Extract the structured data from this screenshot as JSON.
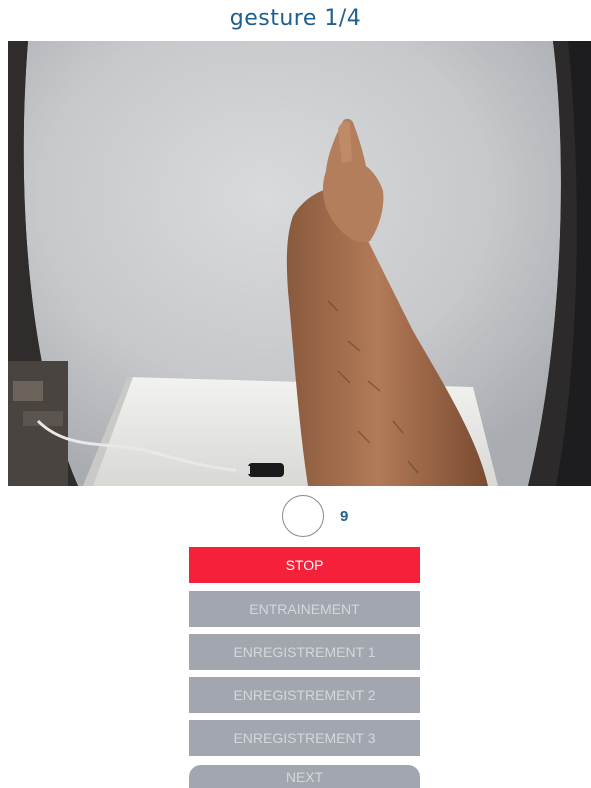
{
  "header": {
    "title": "gesture 1/4"
  },
  "camera": {
    "description_icon": "camera-feed"
  },
  "timer": {
    "count": "9"
  },
  "buttons": {
    "stop": "STOP",
    "entrainement": "ENTRAINEMENT",
    "enregistrement_1": "ENREGISTREMENT 1",
    "enregistrement_2": "ENREGISTREMENT 2",
    "enregistrement_3": "ENREGISTREMENT 3",
    "next": "NEXT"
  },
  "colors": {
    "title": "#1f5f8f",
    "stop_button": "#f5213a",
    "disabled_button": "#a2a6ae",
    "disabled_text": "#d4d7dc"
  }
}
